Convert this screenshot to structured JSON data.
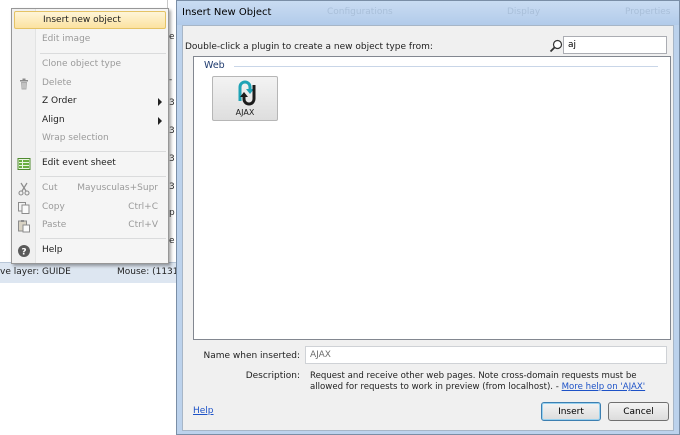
{
  "background": {
    "column_fragments": [
      "e",
      "-",
      "3",
      "3",
      "3",
      "3",
      "p",
      "e"
    ],
    "status": {
      "layer": "ve layer: GUIDE",
      "mouse": "Mouse: (1131"
    }
  },
  "context_menu": {
    "items": [
      {
        "label": "Insert new object",
        "state": "highlighted",
        "icon": ""
      },
      {
        "label": "Edit image",
        "state": "disabled",
        "icon": ""
      },
      {
        "label": "Clone object type",
        "state": "disabled",
        "icon": ""
      },
      {
        "label": "Delete",
        "state": "disabled",
        "icon": "trash-icon"
      },
      {
        "label": "Z Order",
        "state": "enabled",
        "submenu": true
      },
      {
        "label": "Align",
        "state": "enabled",
        "submenu": true
      },
      {
        "label": "Wrap selection",
        "state": "disabled"
      },
      {
        "label": "Edit event sheet",
        "state": "enabled",
        "icon": "event-sheet-icon"
      },
      {
        "label": "Cut",
        "shortcut": "Mayusculas+Supr",
        "state": "disabled",
        "icon": "scissors-icon"
      },
      {
        "label": "Copy",
        "shortcut": "Ctrl+C",
        "state": "disabled",
        "icon": "copy-icon"
      },
      {
        "label": "Paste",
        "shortcut": "Ctrl+V",
        "state": "disabled",
        "icon": "paste-icon"
      },
      {
        "label": "Help",
        "state": "enabled",
        "icon": "help-icon"
      }
    ]
  },
  "dialog": {
    "title": "Insert New Object",
    "title_ghost": [
      "Configurations",
      "Display",
      "Properties"
    ],
    "instruction": "Double-click a plugin to create a new object type from:",
    "search": {
      "value": "aj",
      "placeholder": ""
    },
    "group_label": "Web",
    "plugins": [
      {
        "label": "AJAX",
        "icon": "ajax-arrows-icon"
      }
    ],
    "name_label": "Name when inserted:",
    "name_value": "AJAX",
    "description_label": "Description:",
    "description_text": "Request and receive other web pages.  Note cross-domain requests must be allowed for requests to work in preview (from localhost). - ",
    "description_link": "More help on 'AJAX'",
    "help_link": "Help",
    "insert_button": "Insert",
    "cancel_button": "Cancel"
  },
  "colors": {
    "menu_highlight": "#fce2a0",
    "dialog_frame": "#bcd2ec",
    "link": "#1d52c7",
    "ajax_teal": "#1fa3b6"
  }
}
